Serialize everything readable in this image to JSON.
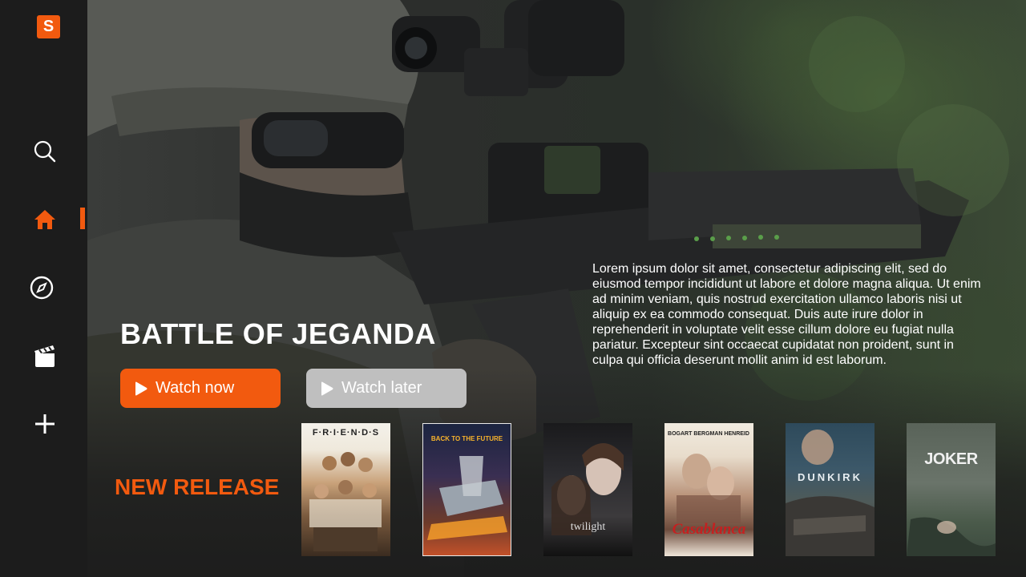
{
  "app": {
    "logo_letter": "S",
    "accent_color": "#f25a0f"
  },
  "sidebar": {
    "items": [
      {
        "name": "search",
        "icon": "search-icon"
      },
      {
        "name": "home",
        "icon": "home-icon",
        "active": true
      },
      {
        "name": "explore",
        "icon": "compass-icon"
      },
      {
        "name": "movies",
        "icon": "clapperboard-icon"
      },
      {
        "name": "add",
        "icon": "plus-icon"
      }
    ]
  },
  "hero": {
    "title": "BATTLE OF JEGANDA",
    "description": "Lorem ipsum dolor sit amet, consectetur adipiscing elit, sed do eiusmod tempor incididunt ut labore et dolore magna aliqua. Ut enim ad minim veniam, quis nostrud exercitation ullamco laboris nisi ut aliquip ex ea commodo consequat. Duis aute irure dolor in reprehenderit in voluptate velit esse cillum dolore eu fugiat nulla pariatur. Excepteur sint occaecat cupidatat non proident, sunt in culpa qui officia deserunt mollit anim id est laborum.",
    "watch_now_label": "Watch now",
    "watch_later_label": "Watch later"
  },
  "new_release": {
    "title": "NEW RELEASE",
    "posters": [
      {
        "title": "F·R·I·E·N·D·S"
      },
      {
        "title": "BACK TO THE FUTURE"
      },
      {
        "title": "twilight"
      },
      {
        "title": "Casablanca"
      },
      {
        "title": "DUNKIRK"
      },
      {
        "title": "JOKER"
      }
    ]
  }
}
